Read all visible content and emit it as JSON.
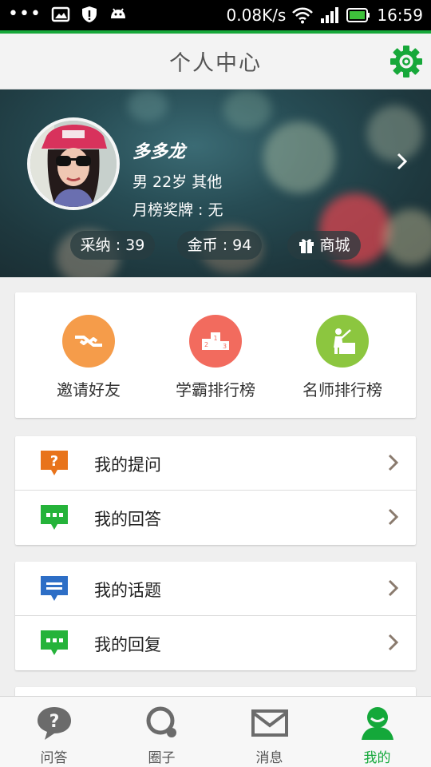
{
  "status_bar": {
    "speed": "0.08K/s",
    "time": "16:59"
  },
  "header": {
    "title": "个人中心"
  },
  "profile": {
    "name": "多多龙",
    "info": "男 22岁 其他",
    "medal": "月榜奖牌 : 无",
    "adopted": "采纳 : 39",
    "coins": "金币 : 94",
    "shop": "商城"
  },
  "quick_actions": [
    {
      "label": "邀请好友",
      "icon": "handshake-icon",
      "color": "#f59c4a"
    },
    {
      "label": "学霸排行榜",
      "icon": "podium-icon",
      "color": "#f26b5e"
    },
    {
      "label": "名师排行榜",
      "icon": "teacher-icon",
      "color": "#8cc63f"
    }
  ],
  "menu_group_1": [
    {
      "label": "我的提问",
      "icon": "question-bubble-icon",
      "color": "#e8731a"
    },
    {
      "label": "我的回答",
      "icon": "answer-bubble-icon",
      "color": "#25b33a"
    }
  ],
  "menu_group_2": [
    {
      "label": "我的话题",
      "icon": "topic-bubble-icon",
      "color": "#2d6ec6"
    },
    {
      "label": "我的回复",
      "icon": "reply-bubble-icon",
      "color": "#25b33a"
    }
  ],
  "bottom_nav": [
    {
      "label": "问答",
      "icon": "qa-icon"
    },
    {
      "label": "圈子",
      "icon": "circle-icon"
    },
    {
      "label": "消息",
      "icon": "mail-icon"
    },
    {
      "label": "我的",
      "icon": "profile-icon",
      "active": true
    }
  ],
  "colors": {
    "accent": "#17a83a",
    "active_tab": "#14a83a"
  }
}
